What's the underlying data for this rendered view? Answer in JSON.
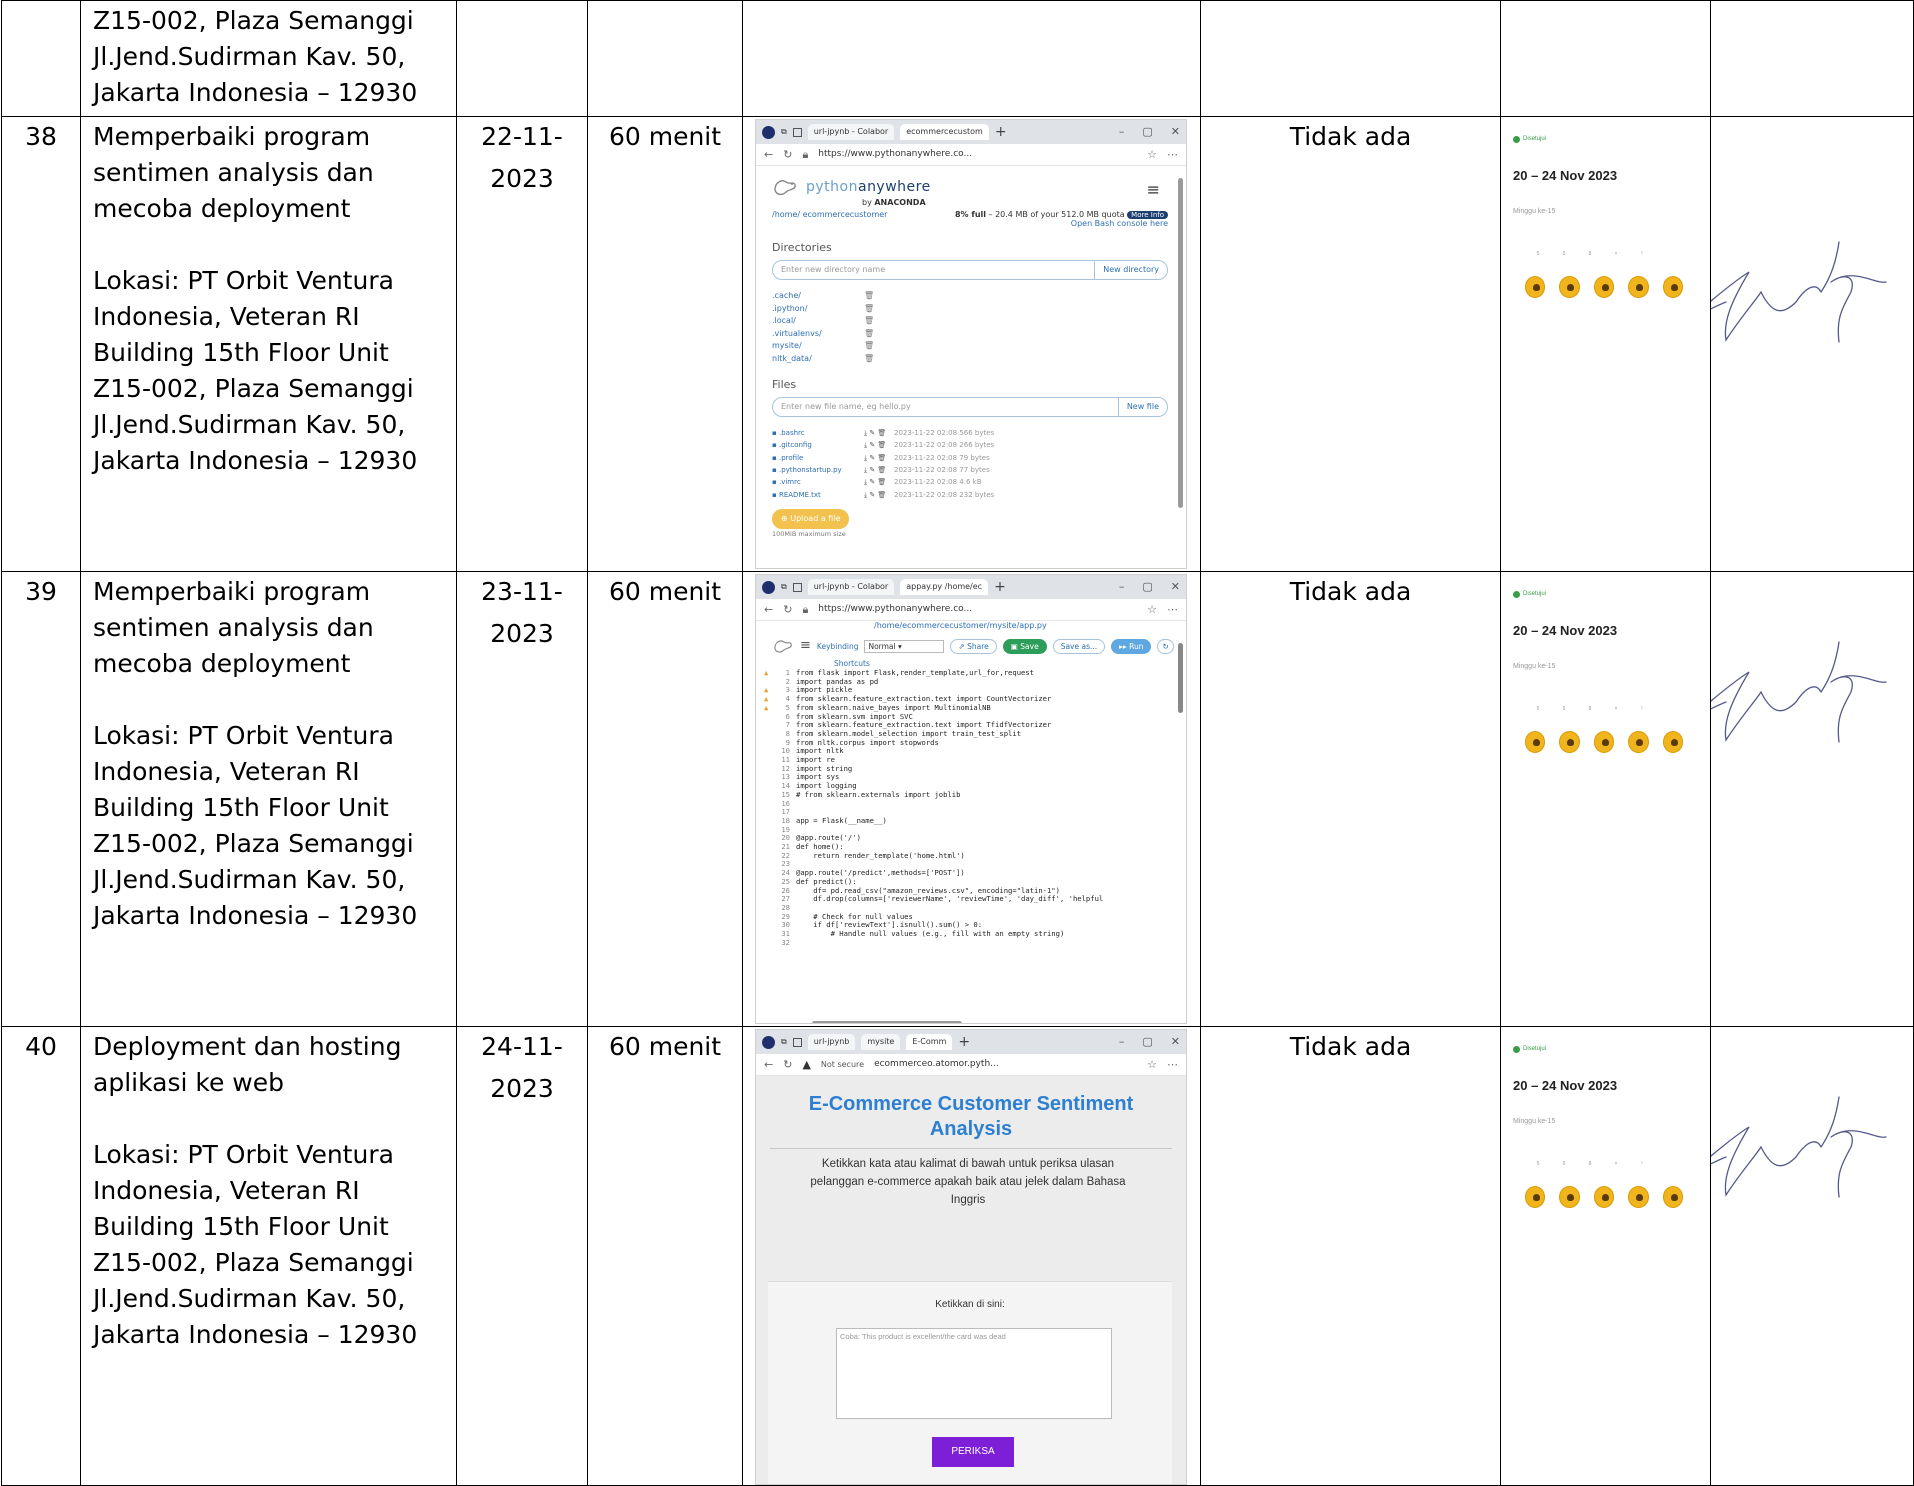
{
  "top_row": {
    "activity_lines": [
      "Z15-002, Plaza Semanggi",
      "Jl.Jend.Sudirman Kav. 50,",
      "Jakarta Indonesia – 12930"
    ]
  },
  "rows": [
    {
      "no": "38",
      "activity_lines": [
        "Memperbaiki program",
        "sentimen analysis dan",
        "mecoba deployment"
      ],
      "location_lines": [
        "Lokasi: PT Orbit Ventura",
        "Indonesia, Veteran RI",
        "Building 15th Floor Unit",
        "Z15-002, Plaza Semanggi",
        "Jl.Jend.Sudirman Kav. 50,",
        "Jakarta Indonesia – 12930"
      ],
      "date_lines": [
        "22-11-",
        "2023"
      ],
      "duration": "60 menit",
      "obstacle": "Tidak ada",
      "approval": {
        "status": "Disetujui",
        "range": "20 – 24 Nov 2023",
        "week": "Minggu ke-15",
        "levels": [
          "5",
          "5",
          "8",
          "×",
          "!"
        ]
      }
    },
    {
      "no": "39",
      "activity_lines": [
        "Memperbaiki program",
        "sentimen analysis dan",
        "mecoba deployment"
      ],
      "location_lines": [
        "Lokasi: PT Orbit Ventura",
        "Indonesia, Veteran RI",
        "Building 15th Floor Unit",
        "Z15-002, Plaza Semanggi",
        "Jl.Jend.Sudirman Kav. 50,",
        "Jakarta Indonesia – 12930"
      ],
      "date_lines": [
        "23-11-",
        "2023"
      ],
      "duration": "60 menit",
      "obstacle": "Tidak ada",
      "approval": {
        "status": "Disetujui",
        "range": "20 – 24 Nov 2023",
        "week": "Minggu ke-15",
        "levels": [
          "5",
          "5",
          "8",
          "×",
          "!"
        ]
      }
    },
    {
      "no": "40",
      "activity_lines": [
        "Deployment  dan hosting",
        "aplikasi ke web"
      ],
      "location_lines": [
        "Lokasi: PT Orbit Ventura",
        "Indonesia, Veteran RI",
        "Building 15th Floor Unit",
        "Z15-002, Plaza Semanggi",
        "Jl.Jend.Sudirman Kav. 50,",
        "Jakarta Indonesia – 12930"
      ],
      "date_lines": [
        "24-11-",
        "2023"
      ],
      "duration": "60 menit",
      "obstacle": "Tidak ada",
      "approval": {
        "status": "Disetujui",
        "range": "20 – 24 Nov 2023",
        "week": "Minggu ke-15",
        "levels": [
          "5",
          "5",
          "8",
          "×",
          "!"
        ]
      }
    }
  ],
  "shot38": {
    "tabs": [
      "url-jpynb - Colabor",
      "ecommercecustom"
    ],
    "url": "https://www.pythonanywhere.co...",
    "brand": "pythonanywhere",
    "brand_a": "python",
    "brand_b": "anywhere",
    "byline_pre": "by ",
    "byline": "ANACONDA",
    "crumb": "/home/ ecommercecustomer",
    "quota_pct": "8% full",
    "quota_rest": " – 20.4 MB of your 512.0 MB quota",
    "more_info": "More Info",
    "console": "Open Bash console here",
    "dirs_heading": "Directories",
    "dir_placeholder": "Enter new directory name",
    "dir_button": "New directory",
    "dirs": [
      ".cache/",
      ".ipython/",
      ".local/",
      ".virtualenvs/",
      "mysite/",
      "nltk_data/"
    ],
    "files_heading": "Files",
    "file_placeholder": "Enter new file name, eg hello.py",
    "file_button": "New file",
    "files": [
      {
        "name": ".bashrc",
        "meta": "2023-11-22 02:08  566 bytes"
      },
      {
        "name": ".gitconfig",
        "meta": "2023-11-22 02:08  266 bytes"
      },
      {
        "name": ".profile",
        "meta": "2023-11-22 02:08  79 bytes"
      },
      {
        "name": ".pythonstartup.py",
        "meta": "2023-11-22 02:08  77 bytes"
      },
      {
        "name": ".vimrc",
        "meta": "2023-11-22 02:08  4.6 kB"
      },
      {
        "name": "README.txt",
        "meta": "2023-11-22 02:08  232 bytes"
      }
    ],
    "upload": "Upload a file",
    "upload_note": "100MiB maximum size"
  },
  "shot39": {
    "tabs": [
      "url-jpynb - Colabor",
      "appay.py /home/ec"
    ],
    "url": "https://www.pythonanywhere.co...",
    "path": "/home/ecommercecustomer/mysite/app.py",
    "keybinding_label": "Keybinding",
    "keybinding_value": "Normal",
    "shortcuts": "Shortcuts",
    "share": "Share",
    "save": "Save",
    "save_as": "Save as...",
    "run": "Run",
    "code": [
      "from flask import Flask,render_template,url_for,request",
      "import pandas as pd",
      "import pickle",
      "from sklearn.feature_extraction.text import CountVectorizer",
      "from sklearn.naive_bayes import MultinomialNB",
      "from sklearn.svm import SVC",
      "from sklearn.feature_extraction.text import TfidfVectorizer",
      "from sklearn.model_selection import train_test_split",
      "from nltk.corpus import stopwords",
      "import nltk",
      "import re",
      "import string",
      "import sys",
      "import logging",
      "# from sklearn.externals import joblib",
      "",
      "",
      "app = Flask(__name__)",
      "",
      "@app.route('/')",
      "def home():",
      "    return render_template('home.html')",
      "",
      "@app.route('/predict',methods=['POST'])",
      "def predict():",
      "    df= pd.read_csv(\"amazon_reviews.csv\", encoding=\"latin-1\")",
      "    df.drop(columns=['reviewerName', 'reviewTime', 'day_diff', 'helpful",
      "",
      "    # Check for null values",
      "    if df['reviewText'].isnull().sum() > 0:",
      "        # Handle null values (e.g., fill with an empty string)",
      ""
    ]
  },
  "shot40": {
    "tabs": [
      "url-jpynb",
      "mysite",
      "E-Comm"
    ],
    "not_secure": "Not secure",
    "url": "ecommerceo.atomor.pyth...",
    "title_lines": [
      "E-Commerce Customer Sentiment",
      "Analysis"
    ],
    "desc_lines": [
      "Ketikkan kata atau kalimat di bawah untuk periksa ulasan",
      "pelanggan e-commerce apakah baik atau jelek dalam Bahasa",
      "Inggris"
    ],
    "input_label": "Ketikkan di sini:",
    "input_placeholder": "Coba: This product is excellent/the card was dead",
    "button": "PERIKSA"
  }
}
